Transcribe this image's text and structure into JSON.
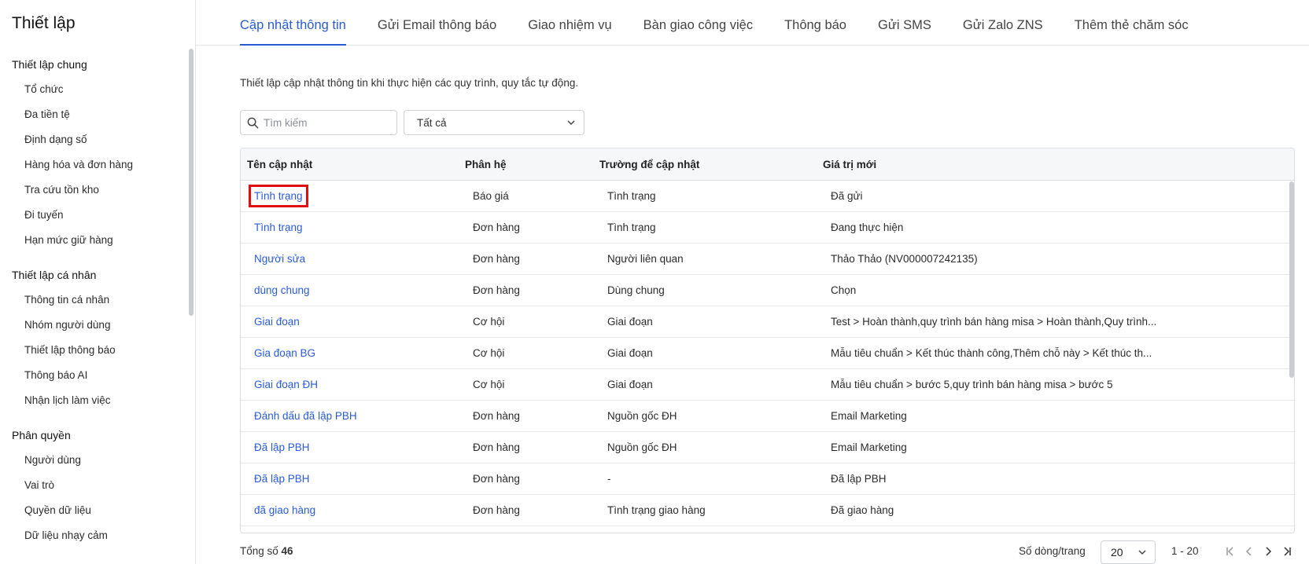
{
  "sidebar": {
    "title": "Thiết lập",
    "groups": [
      {
        "title": "Thiết lập chung",
        "items": [
          "Tổ chức",
          "Đa tiền tệ",
          "Định dạng số",
          "Hàng hóa và đơn hàng",
          "Tra cứu tồn kho",
          "Đi tuyến",
          "Hạn mức giữ hàng"
        ]
      },
      {
        "title": "Thiết lập cá nhân",
        "items": [
          "Thông tin cá nhân",
          "Nhóm người dùng",
          "Thiết lập thông báo",
          "Thông báo AI",
          "Nhận lịch làm việc"
        ]
      },
      {
        "title": "Phân quyền",
        "items": [
          "Người dùng",
          "Vai trò",
          "Quyền dữ liệu",
          "Dữ liệu nhạy cảm"
        ]
      }
    ]
  },
  "tabs": [
    "Cập nhật thông tin",
    "Gửi Email thông báo",
    "Giao nhiệm vụ",
    "Bàn giao công việc",
    "Thông báo",
    "Gửi SMS",
    "Gửi Zalo ZNS",
    "Thêm thẻ chăm sóc"
  ],
  "active_tab": "Cập nhật thông tin",
  "description": "Thiết lập cập nhật thông tin khi thực hiện các quy trình, quy tắc tự động.",
  "search": {
    "placeholder": "Tìm kiếm"
  },
  "filter": {
    "value": "Tất cả"
  },
  "table": {
    "headers": [
      "Tên cập nhật",
      "Phân hệ",
      "Trường để cập nhật",
      "Giá trị mới"
    ],
    "rows": [
      [
        "Tình trạng",
        "Báo giá",
        "Tình trạng",
        "Đã gửi"
      ],
      [
        "Tình trạng",
        "Đơn hàng",
        "Tình trạng",
        "Đang thực hiện"
      ],
      [
        "Người sửa",
        "Đơn hàng",
        "Người liên quan",
        "Thảo Thảo (NV000007242135)"
      ],
      [
        "dùng chung",
        "Đơn hàng",
        "Dùng chung",
        "Chọn"
      ],
      [
        "Giai đoạn",
        "Cơ hội",
        "Giai đoạn",
        "Test > Hoàn thành,quy trình bán hàng misa > Hoàn thành,Quy trình..."
      ],
      [
        "Gia đoạn BG",
        "Cơ hội",
        "Giai đoạn",
        "Mẫu tiêu chuẩn > Kết thúc thành công,Thêm chỗ này > Kết thúc th..."
      ],
      [
        "Giai đoạn ĐH",
        "Cơ hội",
        "Giai đoạn",
        "Mẫu tiêu chuẩn > bước 5,quy trình bán hàng misa > bước 5"
      ],
      [
        "Đánh dấu đã lập PBH",
        "Đơn hàng",
        "Nguồn gốc ĐH",
        "Email Marketing"
      ],
      [
        "Đã lập PBH",
        "Đơn hàng",
        "Nguồn gốc ĐH",
        "Email Marketing"
      ],
      [
        "Đã lập PBH",
        "Đơn hàng",
        "-",
        "Đã lập PBH"
      ],
      [
        "đã giao hàng",
        "Đơn hàng",
        "Tình trạng giao hàng",
        "Đã giao hàng"
      ]
    ]
  },
  "footer": {
    "total_label": "Tổng số",
    "total_value": "46",
    "per_page_label": "Số dòng/trang",
    "per_page_value": "20",
    "range": "1 - 20"
  },
  "colors": {
    "accent": "#2a5bd7",
    "highlight": "#e01010"
  }
}
